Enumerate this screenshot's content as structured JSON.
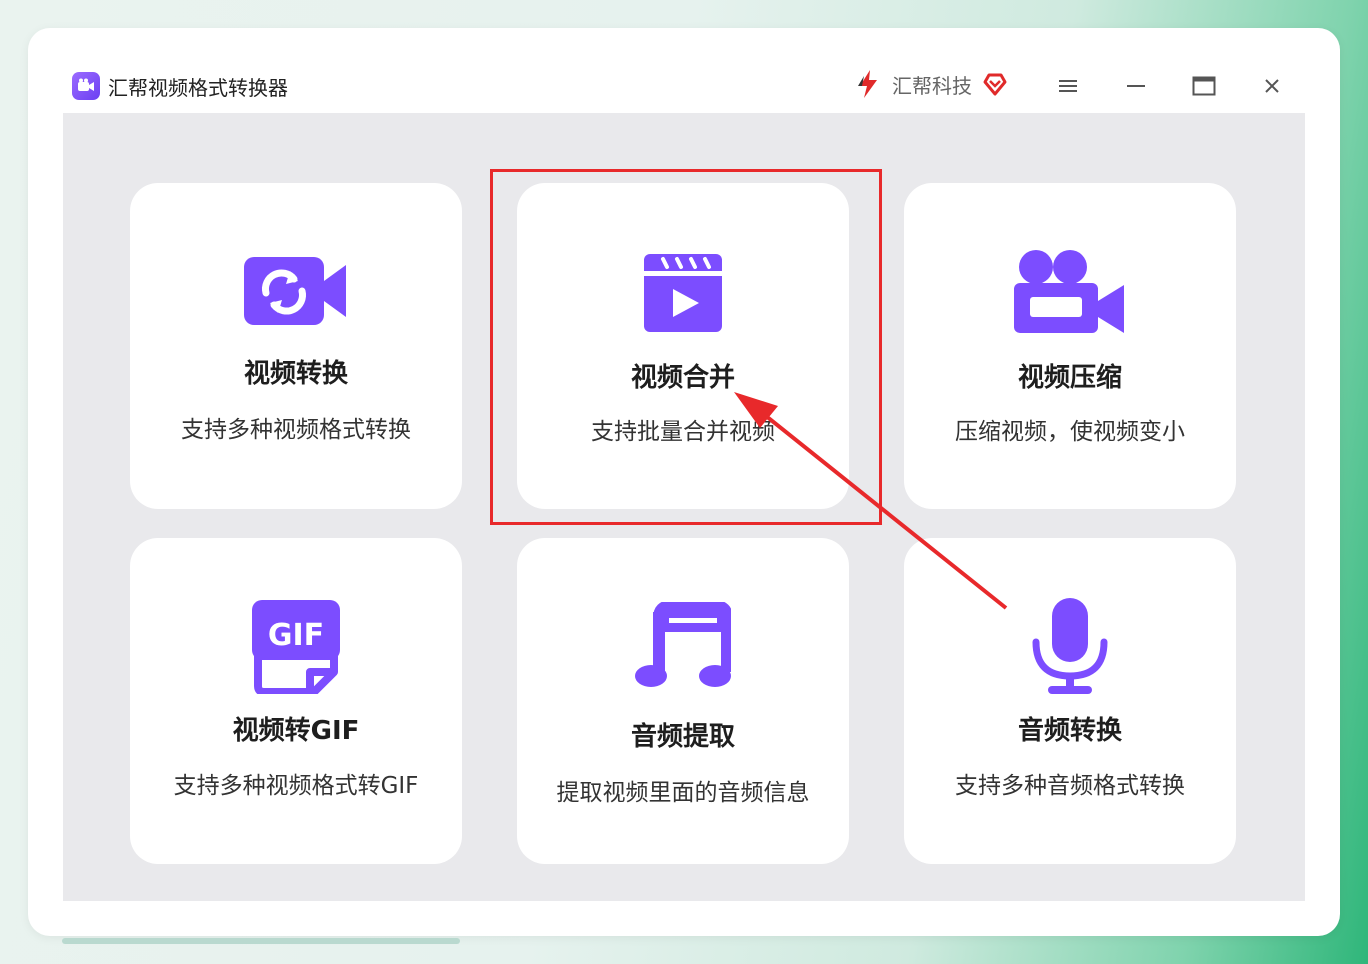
{
  "window": {
    "title": "汇帮视频格式转换器",
    "brand_name": "汇帮科技",
    "controls": [
      "menu-icon",
      "minimize-icon",
      "maximize-icon",
      "close-icon"
    ]
  },
  "cards": [
    {
      "title": "视频转换",
      "desc": "支持多种视频格式转换",
      "icon": "video-convert-icon"
    },
    {
      "title": "视频合并",
      "desc": "支持批量合并视频",
      "icon": "clapperboard-icon"
    },
    {
      "title": "视频压缩",
      "desc": "压缩视频，使视频变小",
      "icon": "video-camera-icon"
    },
    {
      "title": "视频转GIF",
      "desc": "支持多种视频格式转GIF",
      "icon": "gif-icon"
    },
    {
      "title": "音频提取",
      "desc": "提取视频里面的音频信息",
      "icon": "music-note-icon"
    },
    {
      "title": "音频转换",
      "desc": "支持多种音频格式转换",
      "icon": "microphone-icon"
    }
  ],
  "gif_icon_label": "GIF",
  "colors": {
    "accent": "#7c4dff",
    "highlight": "#e8292b",
    "content_bg": "#e9e9ec"
  }
}
